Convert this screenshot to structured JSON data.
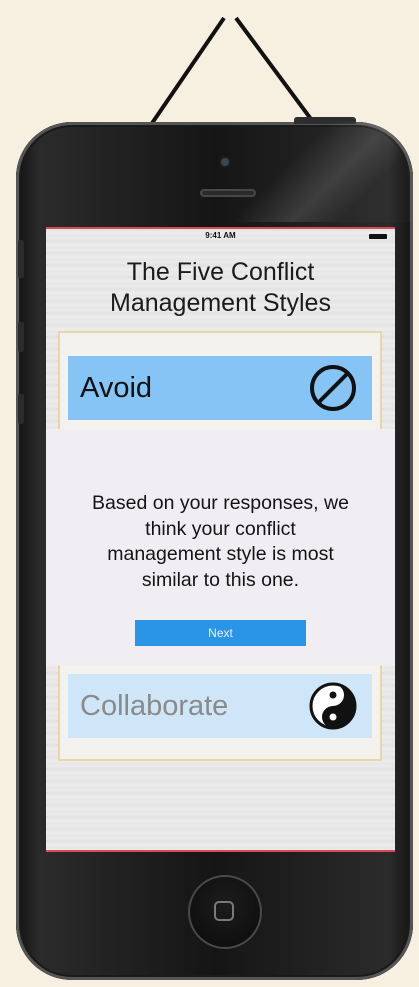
{
  "statusbar": {
    "time": "9:41 AM"
  },
  "screen": {
    "title_line1": "The Five Conflict",
    "title_line2": "Management Styles",
    "styles": [
      {
        "label": "Avoid",
        "icon": "prohibited-icon"
      },
      {
        "label": "Collaborate",
        "icon": "yin-yang-icon"
      }
    ],
    "result": {
      "message_line1": "Based on your responses, we",
      "message_line2": "think your conflict",
      "message_line3": "management style is most",
      "message_line4": "similar to this one.",
      "next_label": "Next"
    }
  },
  "colors": {
    "avoid_bar": "#86c4f6",
    "collaborate_bar": "#cfe6f9",
    "next_button": "#2a95e6",
    "background": "#f7f0e1"
  }
}
